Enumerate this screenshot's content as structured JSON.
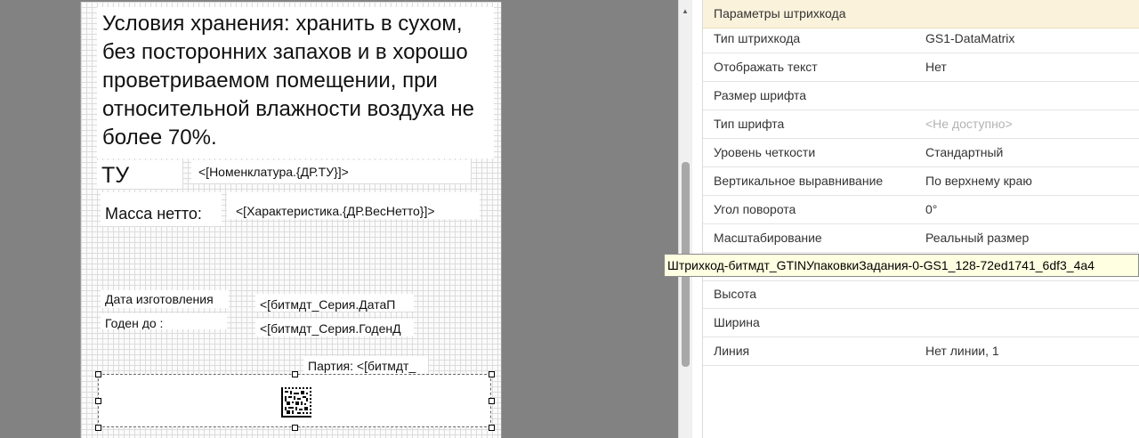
{
  "designer": {
    "storage_text": "Условия хранения: хранить в сухом, без посторонних запахов и в хорошо проветриваемом помещении, при относительной влажности воздуха не более 70%.",
    "tu_label": "ТУ",
    "tu_value": "<[Номенклатура.{ДР.ТУ}]>",
    "mass_label": "Масса нетто:",
    "mass_value": "<[Характеристика.{ДР.ВесНетто}]>",
    "date_label": "Дата изготовления",
    "date_value": "<[битмдт_Серия.ДатаП",
    "expiry_label": "Годен до :",
    "expiry_value": "<[битмдт_Серия.ГоденД",
    "batch_text": "Партия:  <[битмдт_"
  },
  "properties": {
    "header": "Параметры штрихкода",
    "rows": [
      {
        "name": "Тип штрихкода",
        "value": "GS1-DataMatrix"
      },
      {
        "name": "Отображать текст",
        "value": "Нет"
      },
      {
        "name": "Размер шрифта",
        "value": ""
      },
      {
        "name": "Тип шрифта",
        "value": "<Не доступно>"
      },
      {
        "name": "Уровень четкости",
        "value": "Стандартный"
      },
      {
        "name": "Вертикальное выравнивание",
        "value": "По верхнему краю"
      },
      {
        "name": "Угол поворота",
        "value": "0°"
      },
      {
        "name": "Масштабирование",
        "value": "Реальный размер"
      },
      {
        "name": "",
        "value": ""
      },
      {
        "name": "Высота",
        "value": ""
      },
      {
        "name": "Ширина",
        "value": ""
      },
      {
        "name": "Линия",
        "value": "Нет линии, 1"
      }
    ]
  },
  "tooltip": "Штрихкод-битмдт_GTINУпаковкиЗадания-0-GS1_128-72ed1741_6df3_4a4",
  "icons": {
    "scroll_up": "scroll-up-arrow-icon",
    "datamatrix": "datamatrix-barcode-icon"
  }
}
